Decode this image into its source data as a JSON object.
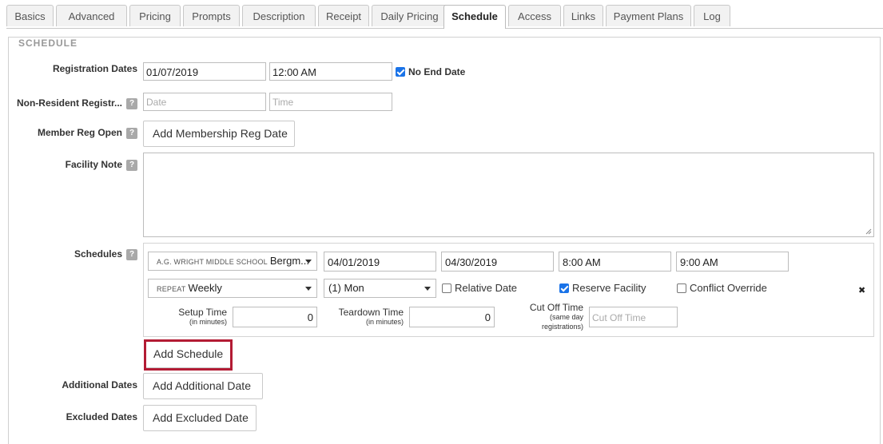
{
  "tabs": [
    {
      "label": "Basics"
    },
    {
      "label": "Advanced"
    },
    {
      "label": "Pricing"
    },
    {
      "label": "Prompts"
    },
    {
      "label": "Description"
    },
    {
      "label": "Receipt"
    },
    {
      "label": "Daily Pricing"
    },
    {
      "label": "Schedule",
      "active": true
    },
    {
      "label": "Access"
    },
    {
      "label": "Links"
    },
    {
      "label": "Payment Plans"
    },
    {
      "label": "Log"
    }
  ],
  "section_title": "SCHEDULE",
  "registration": {
    "label": "Registration Dates",
    "date": "01/07/2019",
    "time": "12:00 AM",
    "no_end_label": "No End Date",
    "no_end_checked": true
  },
  "non_resident": {
    "label": "Non-Resident Registr...",
    "date_placeholder": "Date",
    "time_placeholder": "Time"
  },
  "member_reg": {
    "label": "Member Reg Open",
    "button": "Add Membership Reg Date"
  },
  "facility_note": {
    "label": "Facility Note"
  },
  "schedules": {
    "label": "Schedules",
    "facility_prefix": "A.G. WRIGHT MIDDLE SCHOOL",
    "facility_value": "Bergm...",
    "start_date": "04/01/2019",
    "end_date": "04/30/2019",
    "start_time": "8:00 AM",
    "end_time": "9:00 AM",
    "repeat_prefix": "REPEAT",
    "repeat_value": "Weekly",
    "day_value": "(1) Mon",
    "relative_date_label": "Relative Date",
    "relative_date_checked": false,
    "reserve_facility_label": "Reserve Facility",
    "reserve_facility_checked": true,
    "conflict_override_label": "Conflict Override",
    "conflict_override_checked": false,
    "remove_glyph": "✖",
    "setup_label": "Setup Time",
    "setup_sub": "(in minutes)",
    "setup_value": "0",
    "teardown_label": "Teardown Time",
    "teardown_sub": "(in minutes)",
    "teardown_value": "0",
    "cutoff_label": "Cut Off Time",
    "cutoff_sub1": "(same day",
    "cutoff_sub2": "registrations)",
    "cutoff_placeholder": "Cut Off Time",
    "add_button": "Add Schedule"
  },
  "additional_dates": {
    "label": "Additional Dates",
    "button": "Add Additional Date"
  },
  "excluded_dates": {
    "label": "Excluded Dates",
    "button": "Add Excluded Date"
  },
  "help_glyph": "?",
  "colors": {
    "highlight": "#b31b34",
    "checkbox": "#1a73e8"
  }
}
